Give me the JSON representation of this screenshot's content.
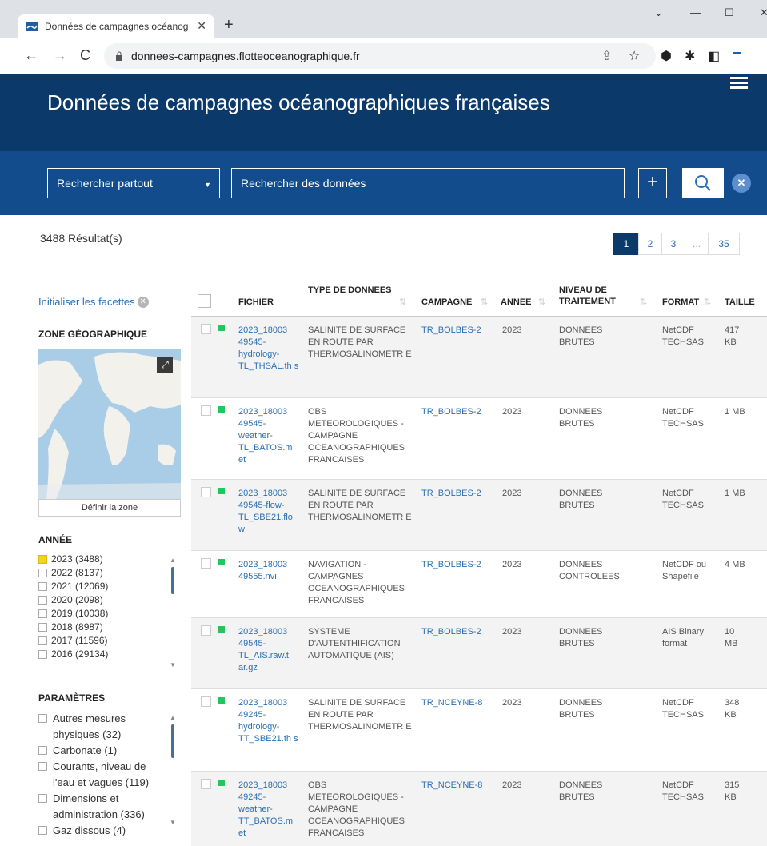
{
  "browser": {
    "tab_title": "Données de campagnes océanog",
    "url": "donnees-campagnes.flotteoceanographique.fr"
  },
  "site": {
    "title": "Données de campagnes océanographiques françaises"
  },
  "search": {
    "scope_label": "Rechercher partout",
    "input_label": "Rechercher des données",
    "plus_label": "+"
  },
  "results": {
    "count_label": "3488 Résultat(s)",
    "pages": [
      "1",
      "2",
      "3",
      "...",
      "35"
    ]
  },
  "facets": {
    "reset_label": "Initialiser les facettes",
    "zone_title": "ZONE GÉOGRAPHIQUE",
    "define_zone_label": "Définir la zone",
    "year_title": "ANNÉE",
    "years": [
      {
        "label": "2023 (3488)",
        "checked": true
      },
      {
        "label": "2022 (8137)",
        "checked": false
      },
      {
        "label": "2021 (12069)",
        "checked": false
      },
      {
        "label": "2020 (2098)",
        "checked": false
      },
      {
        "label": "2019 (10038)",
        "checked": false
      },
      {
        "label": "2018 (8987)",
        "checked": false
      },
      {
        "label": "2017 (11596)",
        "checked": false
      },
      {
        "label": "2016 (29134)",
        "checked": false
      }
    ],
    "params_title": "PARAMÈTRES",
    "params": [
      "Autres mesures physiques (32)",
      "Carbonate (1)",
      "Courants, niveau de l'eau et vagues (119)",
      "Dimensions et administration (336)",
      "Gaz dissous (4)"
    ]
  },
  "table": {
    "headers": {
      "fichier": "FICHIER",
      "type": "TYPE DE DONNEES",
      "campagne": "CAMPAGNE",
      "annee": "ANNEE",
      "niveau": "NIVEAU DE TRAITEMENT",
      "format": "FORMAT",
      "taille": "TAILLE"
    },
    "rows": [
      {
        "fichier": "2023_18003 49545- hydrology- TL_THSAL.th s",
        "type": "SALINITE DE SURFACE EN ROUTE PAR THERMOSALINOMETR E",
        "campagne": "TR_BOLBES-2",
        "annee": "2023",
        "niveau": "DONNEES BRUTES",
        "format": "NetCDF TECHSAS",
        "taille": "417 KB"
      },
      {
        "fichier": "2023_18003 49545- weather- TL_BATOS.m et",
        "type": "OBS METEOROLOGIQUES - CAMPAGNE OCEANOGRAPHIQUES FRANCAISES",
        "campagne": "TR_BOLBES-2",
        "annee": "2023",
        "niveau": "DONNEES BRUTES",
        "format": "NetCDF TECHSAS",
        "taille": "1 MB"
      },
      {
        "fichier": "2023_18003 49545-flow- TL_SBE21.flo w",
        "type": "SALINITE DE SURFACE EN ROUTE PAR THERMOSALINOMETR E",
        "campagne": "TR_BOLBES-2",
        "annee": "2023",
        "niveau": "DONNEES BRUTES",
        "format": "NetCDF TECHSAS",
        "taille": "1 MB"
      },
      {
        "fichier": "2023_18003 49555.nvi",
        "type": "NAVIGATION - CAMPAGNES OCEANOGRAPHIQUES FRANCAISES",
        "campagne": "TR_BOLBES-2",
        "annee": "2023",
        "niveau": "DONNEES CONTROLEES",
        "format": "NetCDF ou Shapefile",
        "taille": "4 MB"
      },
      {
        "fichier": "2023_18003 49545- TL_AIS.raw.t ar.gz",
        "type": "SYSTEME D'AUTENTHIFICATION AUTOMATIQUE (AIS)",
        "campagne": "TR_BOLBES-2",
        "annee": "2023",
        "niveau": "DONNEES BRUTES",
        "format": "AIS Binary format",
        "taille": "10 MB"
      },
      {
        "fichier": "2023_18003 49245- hydrology- TT_SBE21.th s",
        "type": "SALINITE DE SURFACE EN ROUTE PAR THERMOSALINOMETR E",
        "campagne": "TR_NCEYNE-8",
        "annee": "2023",
        "niveau": "DONNEES BRUTES",
        "format": "NetCDF TECHSAS",
        "taille": "348 KB"
      },
      {
        "fichier": "2023_18003 49245- weather- TT_BATOS.m et",
        "type": "OBS METEOROLOGIQUES - CAMPAGNE OCEANOGRAPHIQUES FRANCAISES",
        "campagne": "TR_NCEYNE-8",
        "annee": "2023",
        "niveau": "DONNEES BRUTES",
        "format": "NetCDF TECHSAS",
        "taille": "315 KB"
      }
    ]
  },
  "colors": {
    "header_dark": "#0b3a6a",
    "header_blue": "#124c8c",
    "link": "#2a6fb5",
    "status_green": "#22c55e",
    "year_checked": "#f2d41c"
  }
}
